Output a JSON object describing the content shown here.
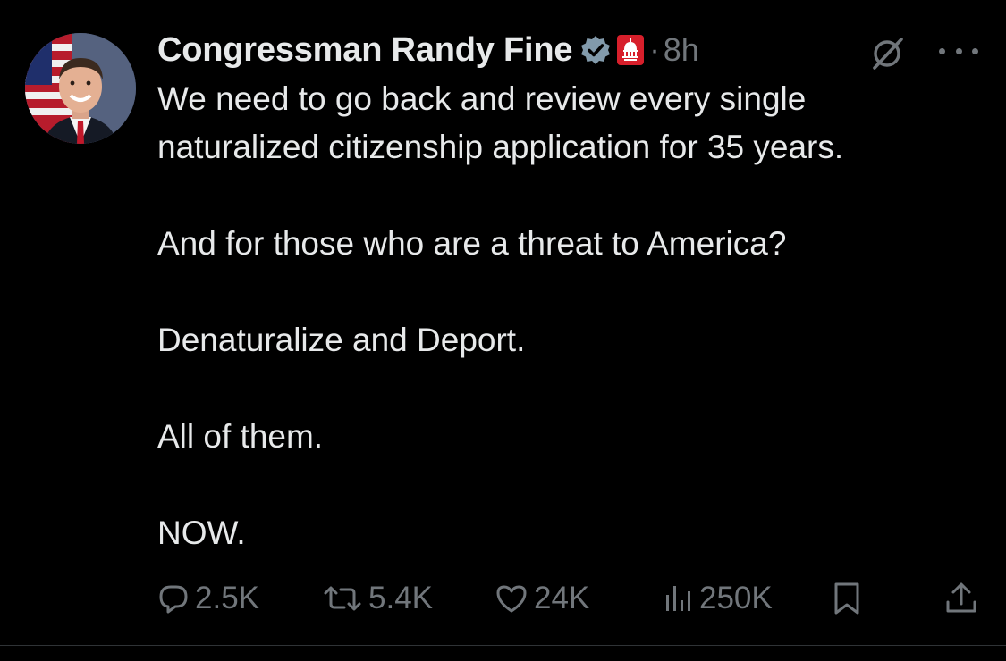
{
  "author": {
    "display_name": "Congressman Randy Fine",
    "verified_icon": "verified-badge-icon",
    "affiliation_icon": "capitol-dome-gop-icon",
    "affiliation_color": "#d71f2b",
    "separator": "·",
    "time": "8h"
  },
  "post": {
    "lines": [
      "We need to go back and review every single",
      "naturalized citizenship application for 35 years.",
      "And for those who are a threat to America?",
      "Denaturalize and Deport.",
      "All of them.",
      "NOW."
    ]
  },
  "actions": {
    "replies": "2.5K",
    "reposts": "5.4K",
    "likes": "24K",
    "views": "250K"
  },
  "colors": {
    "background": "#000000",
    "text": "#e7e9ea",
    "muted": "#71767b",
    "verified": "#829aab"
  }
}
